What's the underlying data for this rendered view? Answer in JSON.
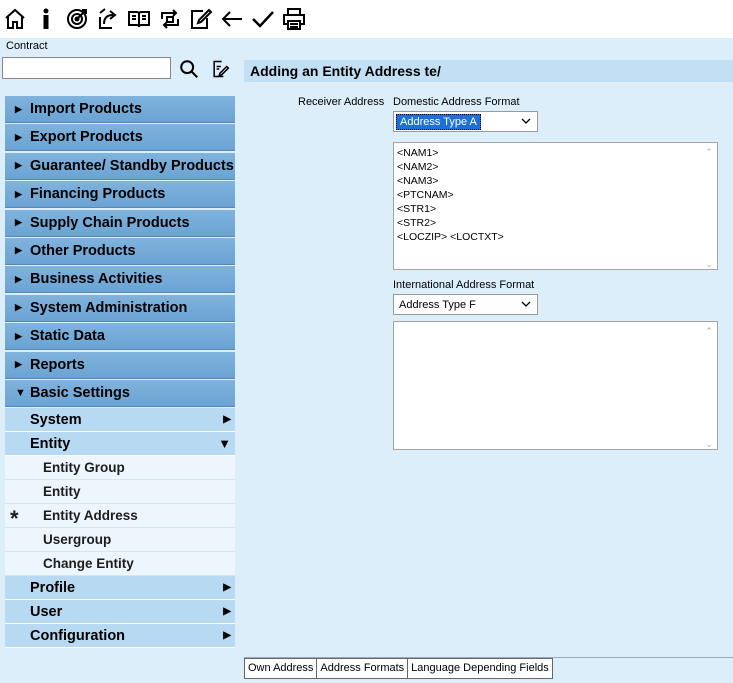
{
  "toolbar": {
    "buttons": [
      {
        "icon": "home-icon"
      },
      {
        "icon": "info-icon"
      },
      {
        "icon": "target-icon"
      },
      {
        "icon": "export-icon"
      },
      {
        "icon": "book-icon"
      },
      {
        "icon": "transfer-icon"
      },
      {
        "icon": "edit-icon"
      },
      {
        "icon": "back-arrow-icon"
      },
      {
        "icon": "checkmark-icon"
      },
      {
        "icon": "printer-icon"
      }
    ]
  },
  "sidebar": {
    "contract_label": "Contract",
    "search_value": "",
    "menu": [
      "Import Products",
      "Export Products",
      "Guarantee/ Standby Products",
      "Financing Products",
      "Supply Chain Products",
      "Other Products",
      "Business Activities",
      "System Administration",
      "Static Data",
      "Reports"
    ],
    "open_menu": "Basic Settings",
    "sub": {
      "system": "System",
      "entity": "Entity",
      "profile": "Profile",
      "user": "User",
      "configuration": "Configuration"
    },
    "leaves": [
      "Entity Group",
      "Entity",
      "Entity Address",
      "Usergroup",
      "Change Entity"
    ],
    "current_marker": "*"
  },
  "main": {
    "title": "Adding an Entity Address te/",
    "receiver_label": "Receiver Address",
    "domestic_label": "Domestic Address Format",
    "domestic_value": "Address Type A",
    "domestic_lines": [
      "<NAM1>",
      "<NAM2>",
      "<NAM3>",
      "<PTCNAM>",
      "<STR1>",
      "<STR2>",
      "<LOCZIP> <LOCTXT>"
    ],
    "international_label": "International Address Format",
    "international_value": "Address Type F",
    "international_lines": []
  },
  "tabs": [
    "Own Address",
    "Address Formats",
    "Language Depending Fields"
  ],
  "colors": {
    "menu_bg": "#6aa3d3",
    "sub_bg": "#b7d9f1",
    "leaf_bg": "#edf6fd",
    "panel_bg": "#dbeefa",
    "selection": "#1e6fd6"
  }
}
